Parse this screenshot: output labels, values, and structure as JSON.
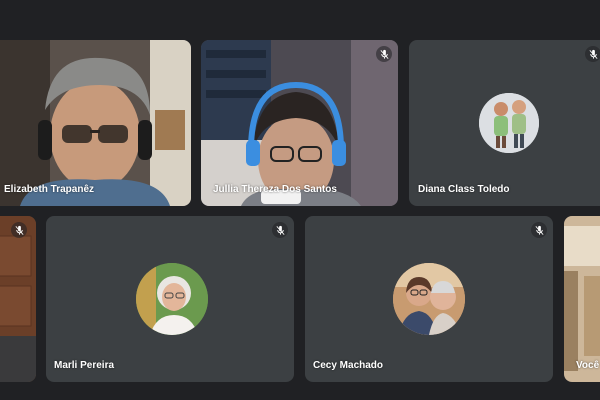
{
  "meeting": {
    "participants": [
      {
        "name": "Elizabeth Trapanêz",
        "video": true,
        "muted": false
      },
      {
        "name": "Jullia Thereza Dos Santos",
        "video": true,
        "muted": true
      },
      {
        "name": "Diana Class Toledo",
        "video": false,
        "muted": true
      },
      {
        "name": "",
        "video": true,
        "muted": true
      },
      {
        "name": "Marli Pereira",
        "video": false,
        "muted": true
      },
      {
        "name": "Cecy Machado",
        "video": false,
        "muted": true
      },
      {
        "name": "Você",
        "video": true,
        "muted": false
      }
    ]
  },
  "icons": {
    "mic_off": "mic-off-icon"
  },
  "colors": {
    "background": "#202124",
    "tile": "#3c4043",
    "text": "#ffffff"
  }
}
